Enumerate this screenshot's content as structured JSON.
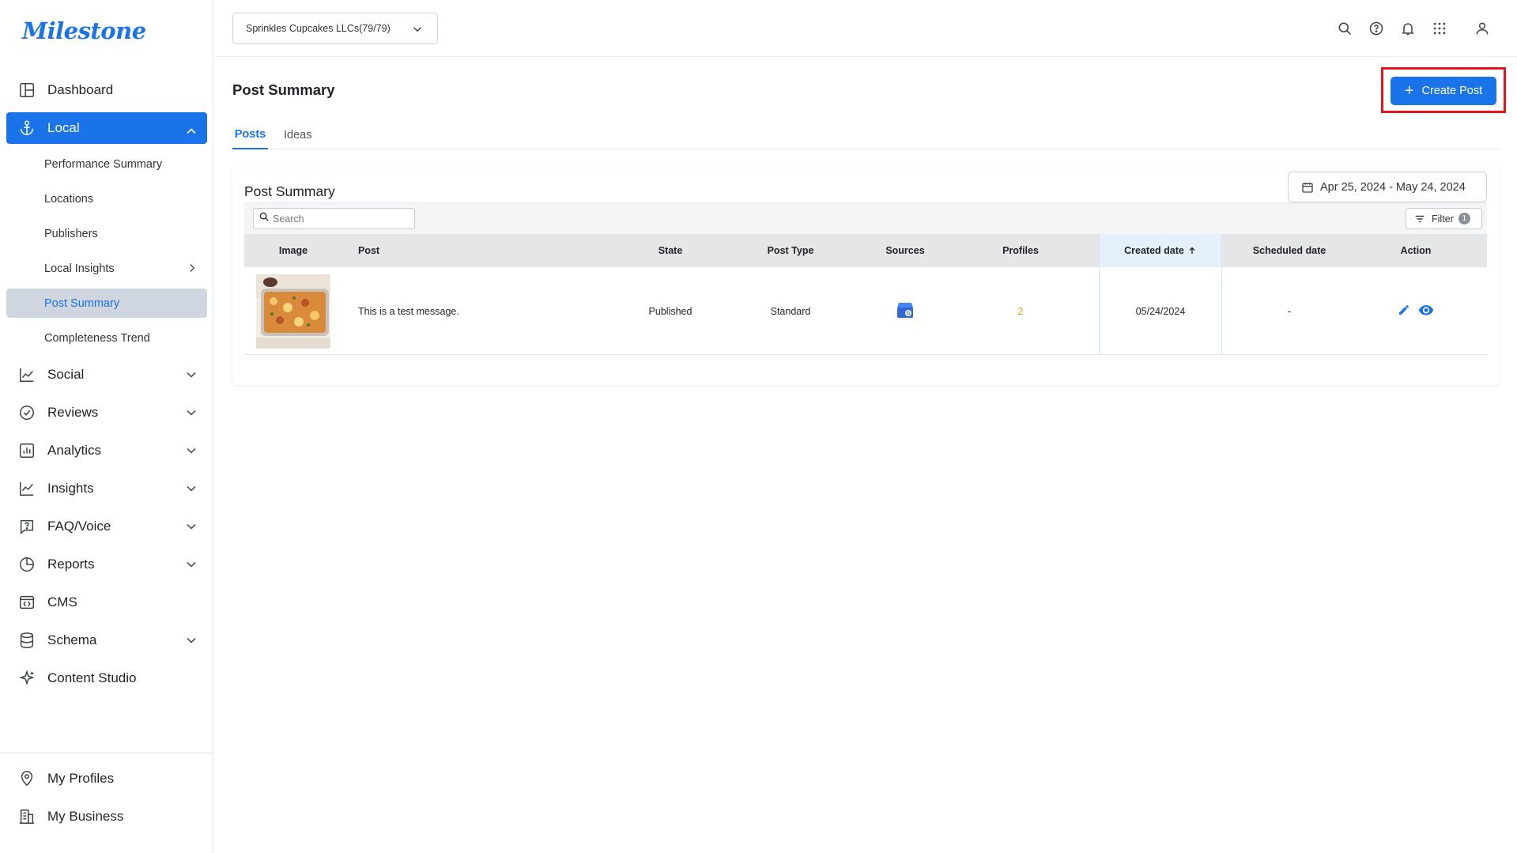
{
  "app": {
    "logo": "Milestone",
    "company_selector": "Sprinkles Cupcakes LLCs(79/79)"
  },
  "sidebar": {
    "items": [
      {
        "label": "Dashboard"
      },
      {
        "label": "Local"
      },
      {
        "label": "Social"
      },
      {
        "label": "Reviews"
      },
      {
        "label": "Analytics"
      },
      {
        "label": "Insights"
      },
      {
        "label": "FAQ/Voice"
      },
      {
        "label": "Reports"
      },
      {
        "label": "CMS"
      },
      {
        "label": "Schema"
      },
      {
        "label": "Content Studio"
      }
    ],
    "local_subitems": [
      {
        "label": "Performance Summary"
      },
      {
        "label": "Locations"
      },
      {
        "label": "Publishers"
      },
      {
        "label": "Local Insights"
      },
      {
        "label": "Post Summary"
      },
      {
        "label": "Completeness Trend"
      }
    ],
    "bottom": [
      {
        "label": "My Profiles"
      },
      {
        "label": "My Business"
      }
    ]
  },
  "topbar": {
    "icons": [
      "search-icon",
      "help-icon",
      "bell-icon",
      "apps-grid-icon",
      "user-icon"
    ]
  },
  "page": {
    "title": "Post Summary",
    "create_button": "Create Post",
    "tabs": [
      {
        "label": "Posts"
      },
      {
        "label": "Ideas"
      }
    ],
    "active_tab": "Posts"
  },
  "card": {
    "title": "Post Summary",
    "date_range": "Apr 25, 2024 - May 24, 2024",
    "search_placeholder": "Search",
    "filter_label": "Filter",
    "filter_count": "1"
  },
  "table": {
    "columns": [
      "Image",
      "Post",
      "State",
      "Post Type",
      "Sources",
      "Profiles",
      "Created date",
      "Scheduled date",
      "Action"
    ],
    "sorted_column": "Created date",
    "sort_direction": "ascending",
    "rows": [
      {
        "post": "This is a test message.",
        "state": "Published",
        "post_type": "Standard",
        "source_icon": "google-business-icon",
        "profiles": "2",
        "created_date": "05/24/2024",
        "scheduled_date": "-"
      }
    ]
  },
  "colors": {
    "accent": "#1a73e8",
    "highlight_outline": "#e8141b",
    "profiles_count": "#f39c12"
  }
}
